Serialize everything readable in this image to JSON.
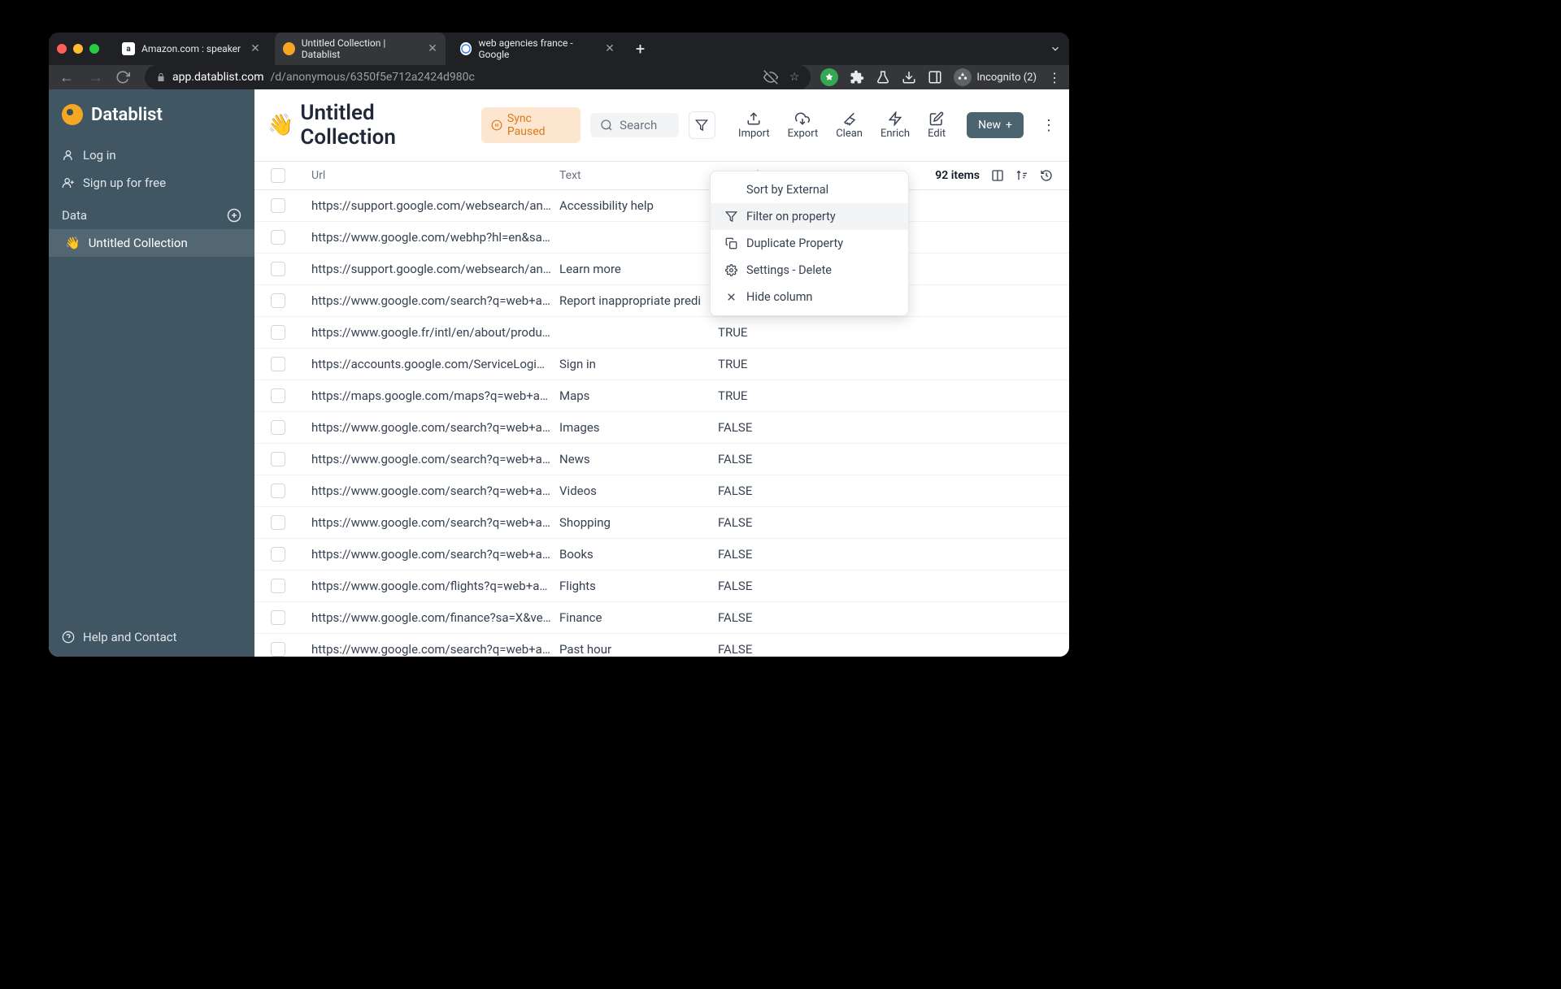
{
  "browser": {
    "tabs": [
      {
        "label": "Amazon.com : speaker",
        "favicon": "amazon"
      },
      {
        "label": "Untitled Collection | Datablist",
        "favicon": "datablist",
        "active": true
      },
      {
        "label": "web agencies france - Google",
        "favicon": "google"
      }
    ],
    "url_host": "app.datablist.com",
    "url_path": "/d/anonymous/6350f5e712a2424d980c",
    "incognito": "Incognito (2)"
  },
  "sidebar": {
    "brand": "Datablist",
    "login": "Log in",
    "signup": "Sign up for free",
    "section": "Data",
    "item": "Untitled Collection",
    "help": "Help and Contact"
  },
  "toolbar": {
    "title": "Untitled Collection",
    "sync": "Sync Paused",
    "search_placeholder": "Search",
    "actions": {
      "import": "Import",
      "export": "Export",
      "clean": "Clean",
      "enrich": "Enrich",
      "edit": "Edit"
    },
    "new_label": "New"
  },
  "table": {
    "headers": {
      "url": "Url",
      "text": "Text",
      "external": "External"
    },
    "count": "92 items",
    "rows": [
      {
        "url": "https://support.google.com/websearch/answer...",
        "text": "Accessibility help",
        "ext": ""
      },
      {
        "url": "https://www.google.com/webhp?hl=en&sa=X&v...",
        "text": "",
        "ext": ""
      },
      {
        "url": "https://support.google.com/websearch/answer...",
        "text": "Learn more",
        "ext": ""
      },
      {
        "url": "https://www.google.com/search?q=web+agenc...",
        "text": "Report inappropriate predi",
        "ext": ""
      },
      {
        "url": "https://www.google.fr/intl/en/about/products?t...",
        "text": "",
        "ext": "TRUE"
      },
      {
        "url": "https://accounts.google.com/ServiceLogin?hl=...",
        "text": "Sign in",
        "ext": "TRUE"
      },
      {
        "url": "https://maps.google.com/maps?q=web+agenci...",
        "text": "Maps",
        "ext": "TRUE"
      },
      {
        "url": "https://www.google.com/search?q=web+agenc...",
        "text": "Images",
        "ext": "FALSE"
      },
      {
        "url": "https://www.google.com/search?q=web+agenc...",
        "text": "News",
        "ext": "FALSE"
      },
      {
        "url": "https://www.google.com/search?q=web+agenc...",
        "text": "Videos",
        "ext": "FALSE"
      },
      {
        "url": "https://www.google.com/search?q=web+agenc...",
        "text": "Shopping",
        "ext": "FALSE"
      },
      {
        "url": "https://www.google.com/search?q=web+agenc...",
        "text": "Books",
        "ext": "FALSE"
      },
      {
        "url": "https://www.google.com/flights?q=web+agenci...",
        "text": "Flights",
        "ext": "FALSE"
      },
      {
        "url": "https://www.google.com/finance?sa=X&ved=2a...",
        "text": "Finance",
        "ext": "FALSE"
      },
      {
        "url": "https://www.google.com/search?q=web+agenc...",
        "text": "Past hour",
        "ext": "FALSE"
      }
    ]
  },
  "ctxmenu": {
    "sort": "Sort by External",
    "filter": "Filter on property",
    "dup": "Duplicate Property",
    "settings": "Settings - Delete",
    "hide": "Hide column"
  }
}
